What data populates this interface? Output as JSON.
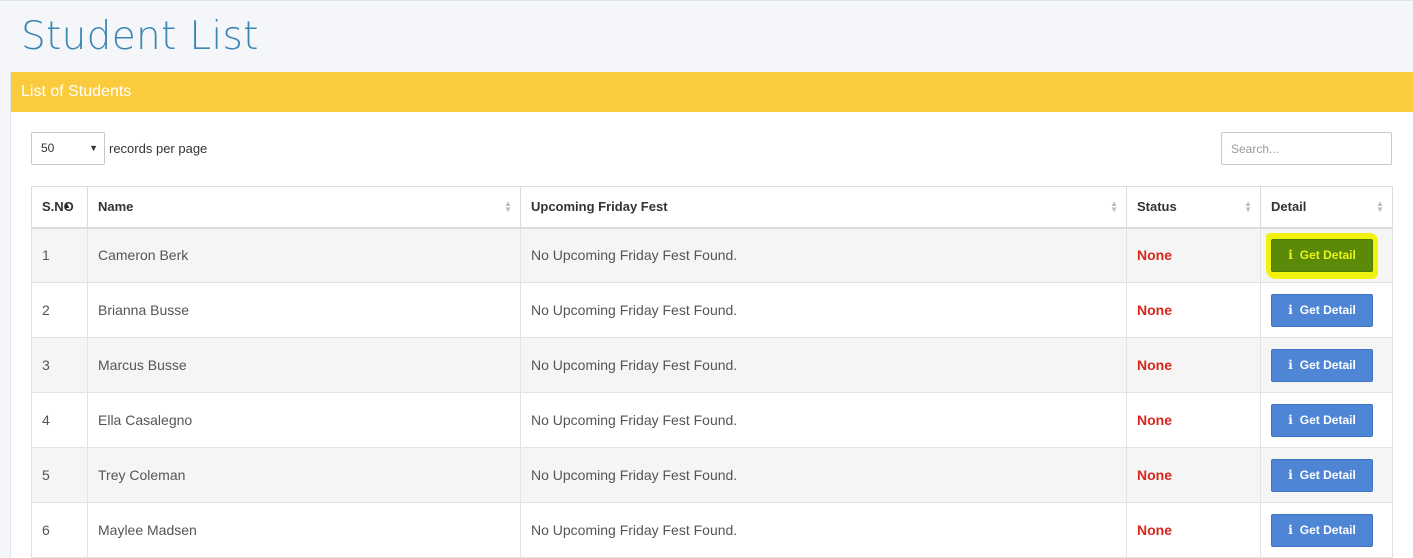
{
  "page": {
    "title": "Student List"
  },
  "panel": {
    "header": "List of Students"
  },
  "controls": {
    "page_size": "50",
    "records_label": "records per page",
    "search_placeholder": "Search..."
  },
  "table": {
    "columns": [
      "S.NO",
      "Name",
      "Upcoming Friday Fest",
      "Status",
      "Detail"
    ],
    "rows": [
      {
        "sno": "1",
        "name": "Cameron Berk",
        "fest": "No Upcoming Friday Fest Found.",
        "status": "None",
        "detail": "Get Detail"
      },
      {
        "sno": "2",
        "name": "Brianna Busse",
        "fest": "No Upcoming Friday Fest Found.",
        "status": "None",
        "detail": "Get Detail"
      },
      {
        "sno": "3",
        "name": "Marcus Busse",
        "fest": "No Upcoming Friday Fest Found.",
        "status": "None",
        "detail": "Get Detail"
      },
      {
        "sno": "4",
        "name": "Ella Casalegno",
        "fest": "No Upcoming Friday Fest Found.",
        "status": "None",
        "detail": "Get Detail"
      },
      {
        "sno": "5",
        "name": "Trey Coleman",
        "fest": "No Upcoming Friday Fest Found.",
        "status": "None",
        "detail": "Get Detail"
      },
      {
        "sno": "6",
        "name": "Maylee Madsen",
        "fest": "No Upcoming Friday Fest Found.",
        "status": "None",
        "detail": "Get Detail"
      }
    ]
  },
  "icons": {
    "sort": "sort-icon",
    "sort_asc": "sort-asc-icon",
    "info": "info-icon",
    "select_caret": "caret-down-icon"
  },
  "colors": {
    "title": "#3a86b3",
    "panel_header": "#fbcb3e",
    "status": "#d9261c",
    "button": "#4e85d5",
    "button_selected": "#5a8a08",
    "highlight": "#f2f20f"
  }
}
